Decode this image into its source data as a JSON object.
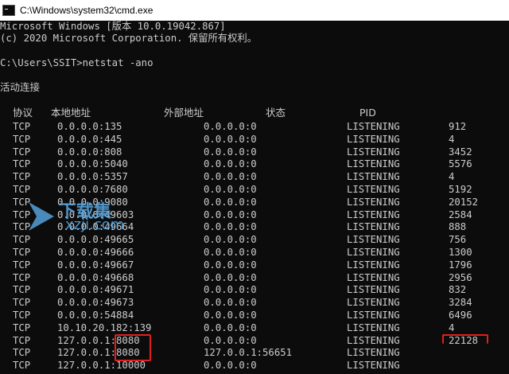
{
  "window": {
    "title": "C:\\Windows\\system32\\cmd.exe"
  },
  "console": {
    "banner1": "Microsoft Windows [版本 10.0.19042.867]",
    "banner2": "(c) 2020 Microsoft Corporation. 保留所有权利。",
    "prompt": "C:\\Users\\SSIT>netstat -ano",
    "section": "活动连接",
    "headers": {
      "proto": "协议",
      "local": "本地地址",
      "foreign": "外部地址",
      "state": "状态",
      "pid": "PID"
    },
    "rows": [
      {
        "proto": "TCP",
        "local": "0.0.0.0:135",
        "foreign": "0.0.0.0:0",
        "state": "LISTENING",
        "pid": "912"
      },
      {
        "proto": "TCP",
        "local": "0.0.0.0:445",
        "foreign": "0.0.0.0:0",
        "state": "LISTENING",
        "pid": "4"
      },
      {
        "proto": "TCP",
        "local": "0.0.0.0:808",
        "foreign": "0.0.0.0:0",
        "state": "LISTENING",
        "pid": "3452"
      },
      {
        "proto": "TCP",
        "local": "0.0.0.0:5040",
        "foreign": "0.0.0.0:0",
        "state": "LISTENING",
        "pid": "5576"
      },
      {
        "proto": "TCP",
        "local": "0.0.0.0:5357",
        "foreign": "0.0.0.0:0",
        "state": "LISTENING",
        "pid": "4"
      },
      {
        "proto": "TCP",
        "local": "0.0.0.0:7680",
        "foreign": "0.0.0.0:0",
        "state": "LISTENING",
        "pid": "5192"
      },
      {
        "proto": "TCP",
        "local": "0.0.0.0:9080",
        "foreign": "0.0.0.0:0",
        "state": "LISTENING",
        "pid": "20152"
      },
      {
        "proto": "TCP",
        "local": "0.0.0.0:49603",
        "foreign": "0.0.0.0:0",
        "state": "LISTENING",
        "pid": "2584"
      },
      {
        "proto": "TCP",
        "local": "0.0.0.0:49664",
        "foreign": "0.0.0.0:0",
        "state": "LISTENING",
        "pid": "888"
      },
      {
        "proto": "TCP",
        "local": "0.0.0.0:49665",
        "foreign": "0.0.0.0:0",
        "state": "LISTENING",
        "pid": "756"
      },
      {
        "proto": "TCP",
        "local": "0.0.0.0:49666",
        "foreign": "0.0.0.0:0",
        "state": "LISTENING",
        "pid": "1300"
      },
      {
        "proto": "TCP",
        "local": "0.0.0.0:49667",
        "foreign": "0.0.0.0:0",
        "state": "LISTENING",
        "pid": "1796"
      },
      {
        "proto": "TCP",
        "local": "0.0.0.0:49668",
        "foreign": "0.0.0.0:0",
        "state": "LISTENING",
        "pid": "2956"
      },
      {
        "proto": "TCP",
        "local": "0.0.0.0:49671",
        "foreign": "0.0.0.0:0",
        "state": "LISTENING",
        "pid": "832"
      },
      {
        "proto": "TCP",
        "local": "0.0.0.0:49673",
        "foreign": "0.0.0.0:0",
        "state": "LISTENING",
        "pid": "3284"
      },
      {
        "proto": "TCP",
        "local": "0.0.0.0:54884",
        "foreign": "0.0.0.0:0",
        "state": "LISTENING",
        "pid": "6496"
      },
      {
        "proto": "TCP",
        "local": "10.10.20.182:139",
        "foreign": "0.0.0.0:0",
        "state": "LISTENING",
        "pid": "4"
      },
      {
        "proto": "TCP",
        "local": "127.0.0.1:8080",
        "foreign": "0.0.0.0:0",
        "state": "LISTENING",
        "pid": "22128"
      },
      {
        "proto": "TCP",
        "local": "127.0.0.1:8080",
        "foreign": "127.0.0.1:56651",
        "state": "LISTENING",
        "pid": ""
      },
      {
        "proto": "TCP",
        "local": "127.0.0.1:10000",
        "foreign": "0.0.0.0:0",
        "state": "LISTENING",
        "pid": ""
      }
    ]
  },
  "watermark": {
    "text": "下载集",
    "sub": "xzji.com"
  },
  "colors": {
    "background": "#0c0c0c",
    "text": "#cccccc",
    "highlight": "#e02020",
    "watermark": "#5aaae6"
  }
}
